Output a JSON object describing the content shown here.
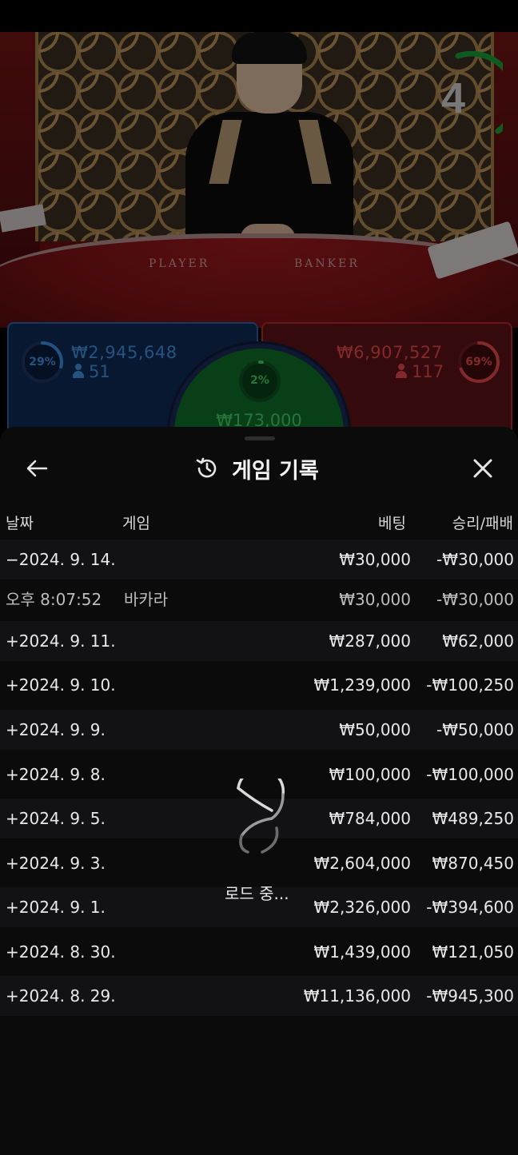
{
  "video": {
    "countdown": "4",
    "table_labels": {
      "player": "PLAYER",
      "banker": "BANKER"
    }
  },
  "bets": {
    "player": {
      "percent": "29%",
      "percent_value": 0.29,
      "amount": "₩2,945,648",
      "players": "51",
      "color": "#3a8ee0"
    },
    "banker": {
      "percent": "69%",
      "percent_value": 0.69,
      "amount": "₩6,907,527",
      "players": "117",
      "color": "#e0474c"
    },
    "tie": {
      "percent": "2%",
      "percent_value": 0.02,
      "amount": "₩173,000",
      "color": "#45c96a"
    }
  },
  "sheet": {
    "title": "게임 기록",
    "icons": {
      "back": "arrow-left-icon",
      "history": "history-icon",
      "close": "close-icon"
    },
    "columns": {
      "date": "날짜",
      "game": "게임",
      "bet": "베팅",
      "result": "승리/패배"
    },
    "rows": [
      {
        "date": "−2024. 9. 14.",
        "game": "",
        "bet": "₩30,000",
        "result": "-₩30,000",
        "kind": "group"
      },
      {
        "date": "오후 8:07:52",
        "game": "바카라",
        "bet": "₩30,000",
        "result": "-₩30,000",
        "kind": "detail"
      },
      {
        "date": "+2024. 9. 11.",
        "game": "",
        "bet": "₩287,000",
        "result": "₩62,000",
        "kind": "group"
      },
      {
        "date": "+2024. 9. 10.",
        "game": "",
        "bet": "₩1,239,000",
        "result": "-₩100,250",
        "kind": "group"
      },
      {
        "date": "+2024. 9. 9.",
        "game": "",
        "bet": "₩50,000",
        "result": "-₩50,000",
        "kind": "group"
      },
      {
        "date": "+2024. 9. 8.",
        "game": "",
        "bet": "₩100,000",
        "result": "-₩100,000",
        "kind": "group"
      },
      {
        "date": "+2024. 9. 5.",
        "game": "",
        "bet": "₩784,000",
        "result": "₩489,250",
        "kind": "group"
      },
      {
        "date": "+2024. 9. 3.",
        "game": "",
        "bet": "₩2,604,000",
        "result": "₩870,450",
        "kind": "group"
      },
      {
        "date": "+2024. 9. 1.",
        "game": "",
        "bet": "₩2,326,000",
        "result": "-₩394,600",
        "kind": "group"
      },
      {
        "date": "+2024. 8. 30.",
        "game": "",
        "bet": "₩1,439,000",
        "result": "₩121,050",
        "kind": "group"
      },
      {
        "date": "+2024. 8. 29.",
        "game": "",
        "bet": "₩11,136,000",
        "result": "-₩945,300",
        "kind": "group"
      }
    ],
    "loading_text": "로드 중..."
  }
}
